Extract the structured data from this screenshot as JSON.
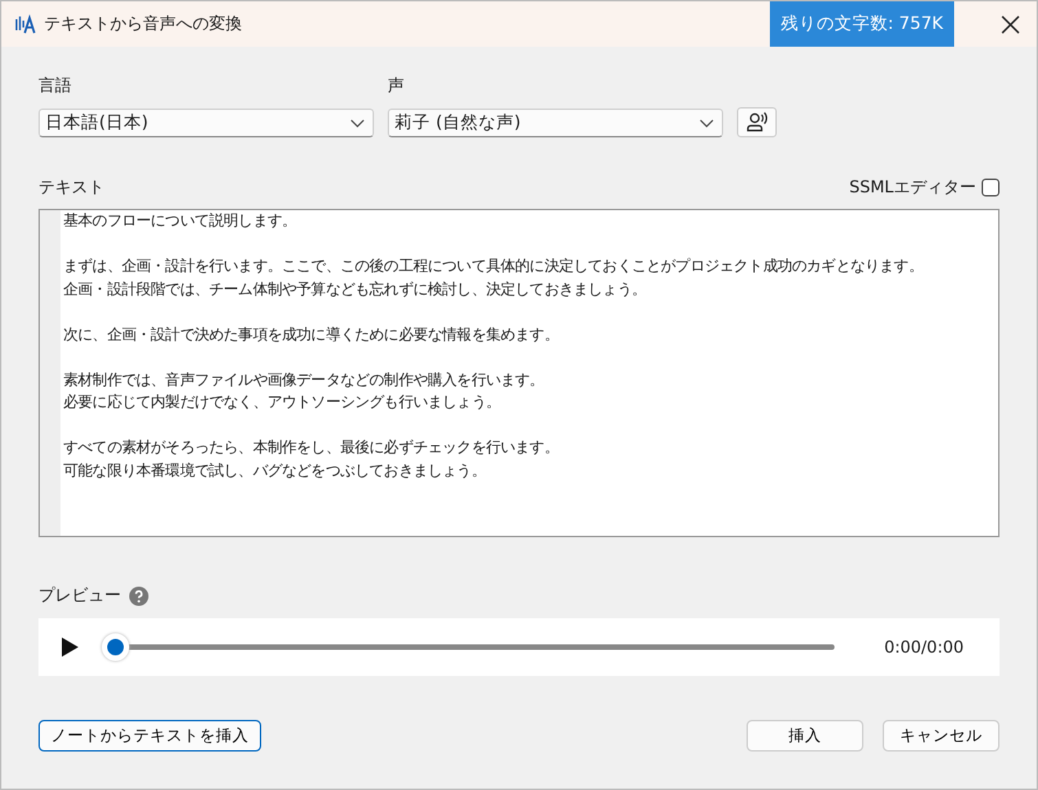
{
  "window": {
    "title": "テキストから音声への変換",
    "quota_badge": "残りの文字数: 757K"
  },
  "language": {
    "label": "言語",
    "value": "日本語(日本)"
  },
  "voice": {
    "label": "声",
    "value": "莉子 (自然な声)"
  },
  "text": {
    "label": "テキスト",
    "ssml_label": "SSMLエディター",
    "ssml_checked": false,
    "paragraphs": [
      [
        "基本のフローについて説明します。"
      ],
      [
        "まずは、企画・設計を行います。ここで、この後の工程について具体的に決定しておくことがプロジェクト成功のカギとなります。",
        "企画・設計段階では、チーム体制や予算なども忘れずに検討し、決定しておきましょう。"
      ],
      [
        "次に、企画・設計で決めた事項を成功に導くために必要な情報を集めます。"
      ],
      [
        "素材制作では、音声ファイルや画像データなどの制作や購入を行います。",
        "必要に応じて内製だけでなく、アウトソーシングも行いましょう。"
      ],
      [
        "すべての素材がそろったら、本制作をし、最後に必ずチェックを行います。",
        "可能な限り本番環境で試し、バグなどをつぶしておきましょう。"
      ]
    ]
  },
  "preview": {
    "label": "プレビュー",
    "level": 0,
    "time": "0:00/0:00"
  },
  "buttons": {
    "insert_from_notes": "ノートからテキストを挿入",
    "insert": "挿入",
    "cancel": "キャンセル"
  }
}
